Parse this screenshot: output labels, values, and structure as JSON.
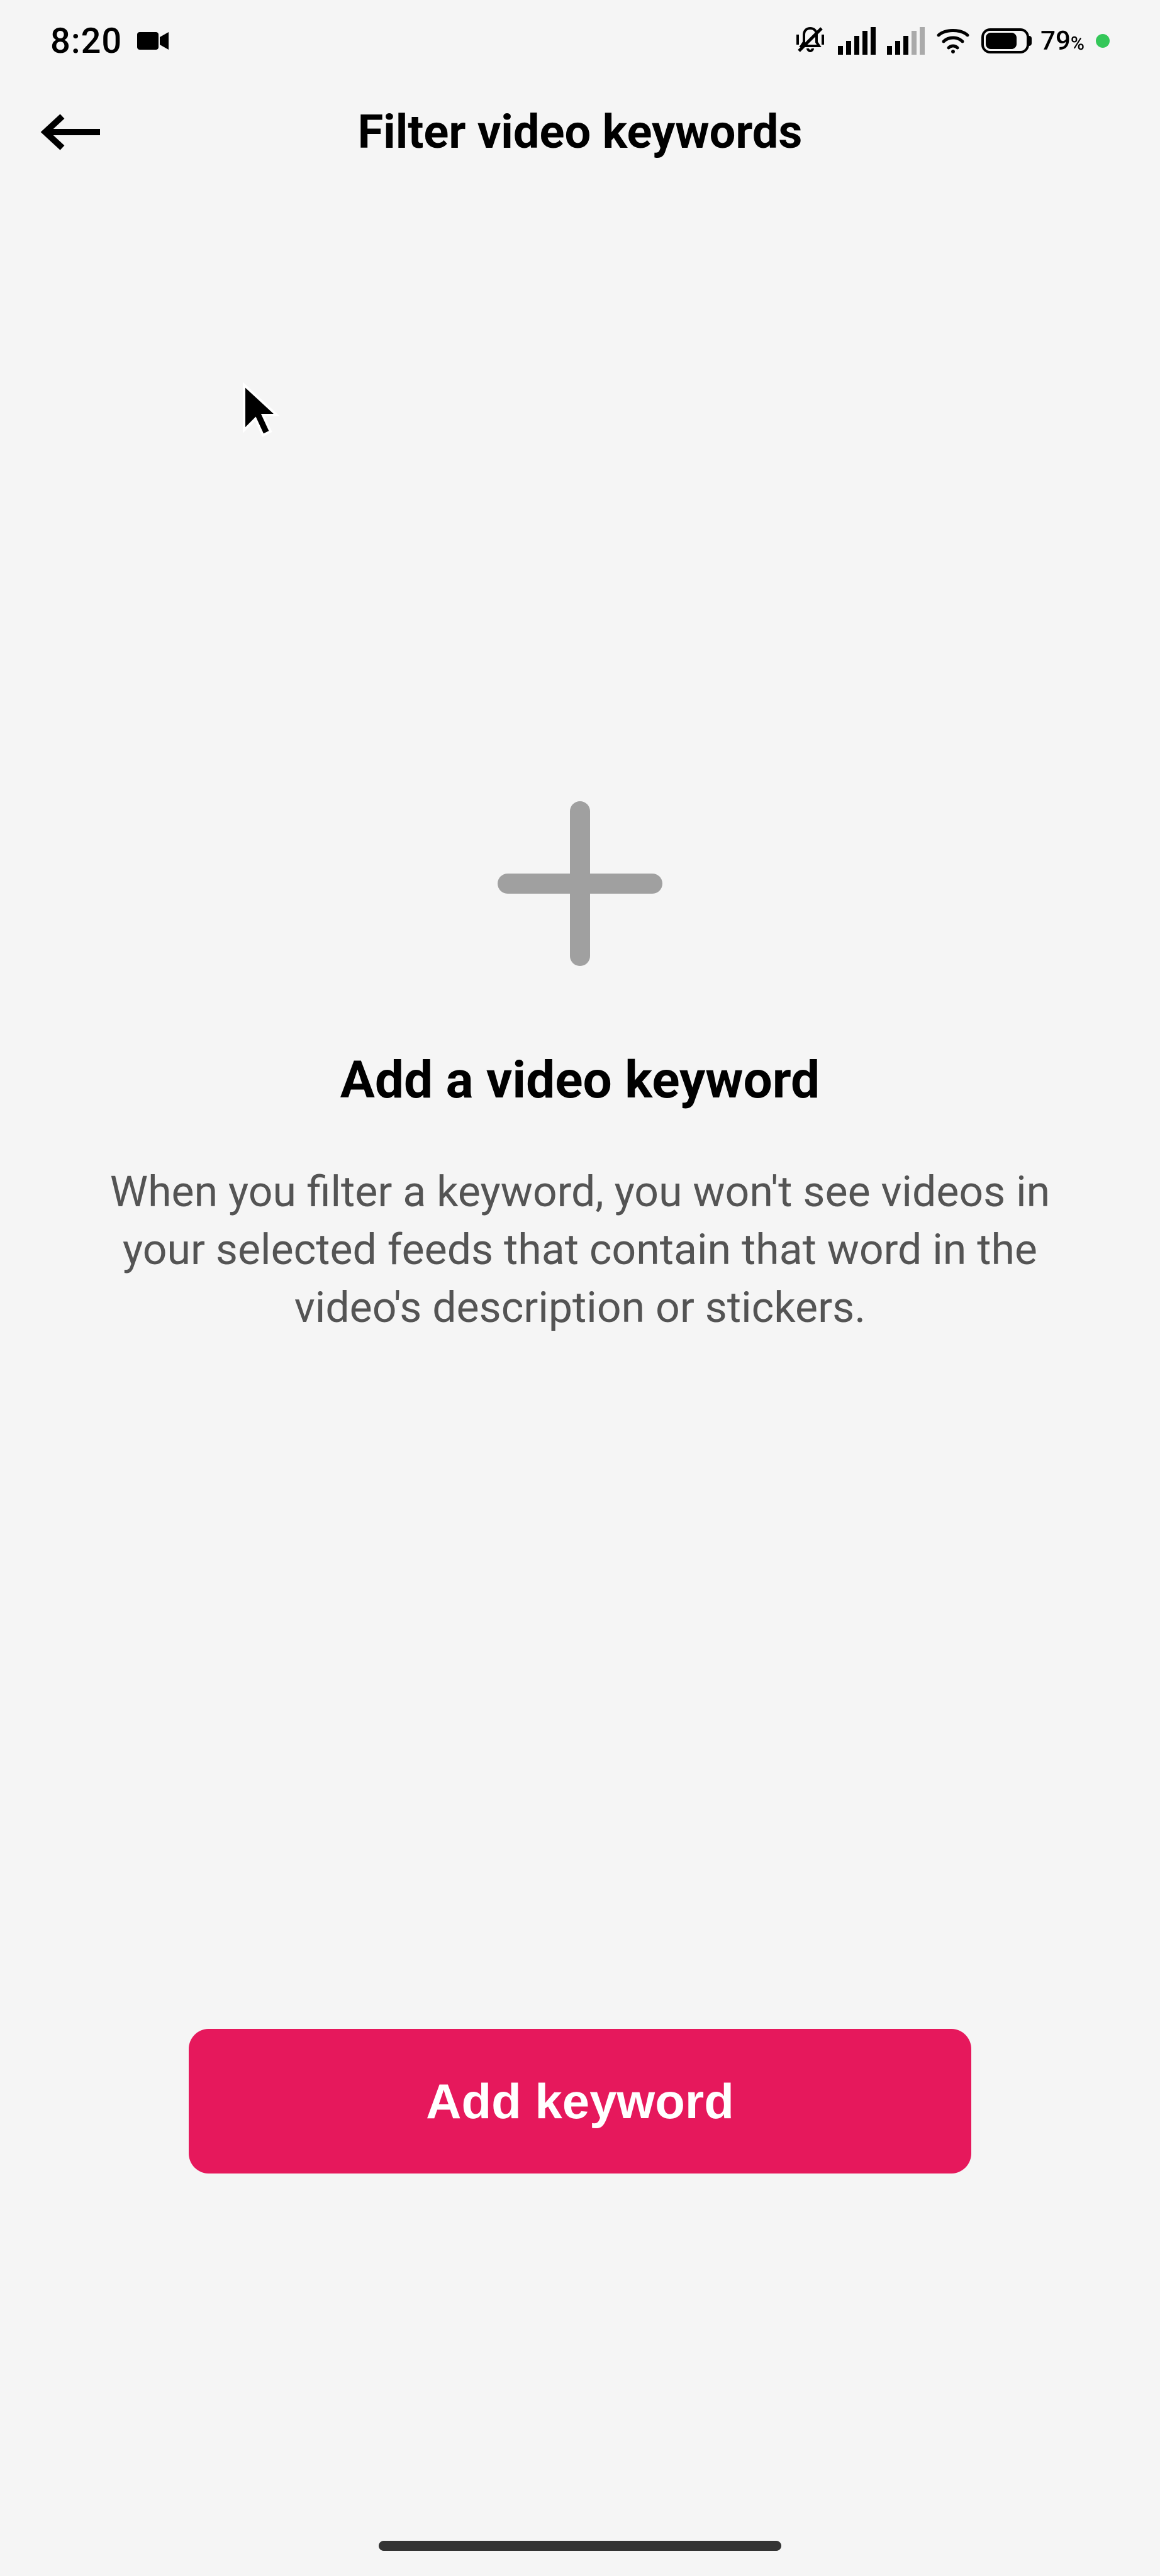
{
  "statusBar": {
    "time": "8:20",
    "batteryPercent": "79"
  },
  "header": {
    "title": "Filter video keywords"
  },
  "emptyState": {
    "title": "Add a video keyword",
    "description": "When you filter a keyword, you won't see videos in your selected feeds that contain that word in the video's description or stickers."
  },
  "button": {
    "label": "Add keyword"
  }
}
